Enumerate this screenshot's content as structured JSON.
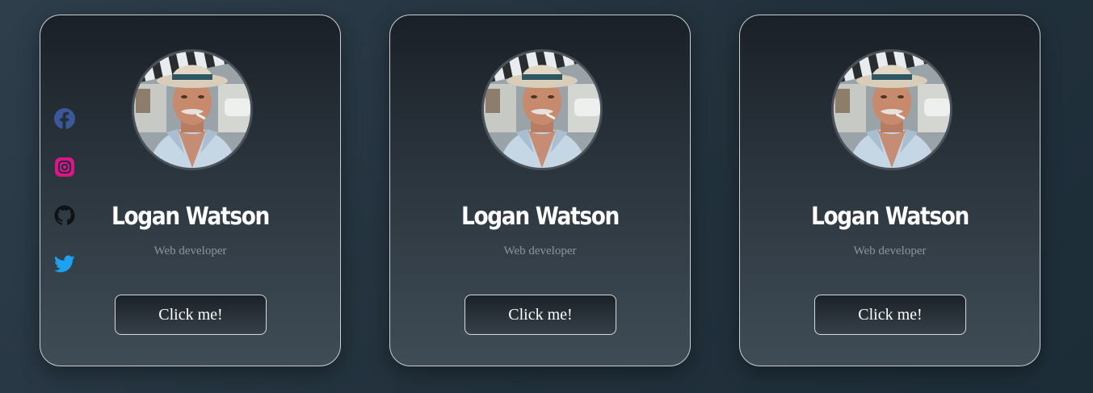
{
  "cards": [
    {
      "name": "Logan Watson",
      "role": "Web developer",
      "button_label": "Click me!",
      "avatar": "man-in-hat-photo",
      "socials": [
        {
          "icon": "facebook-icon",
          "color": "#3b5998"
        },
        {
          "icon": "instagram-icon",
          "color": "#e4138c"
        },
        {
          "icon": "github-icon",
          "color": "#111111"
        },
        {
          "icon": "twitter-icon",
          "color": "#1da1f2"
        }
      ]
    },
    {
      "name": "Logan Watson",
      "role": "Web developer",
      "button_label": "Click me!",
      "avatar": "man-in-hat-photo"
    },
    {
      "name": "Logan Watson",
      "role": "Web developer",
      "button_label": "Click me!",
      "avatar": "man-in-hat-photo"
    }
  ],
  "colors": {
    "background": "#22313c",
    "card_border": "#c9ced3",
    "name_text": "#ffffff",
    "role_text": "#8c959c"
  }
}
